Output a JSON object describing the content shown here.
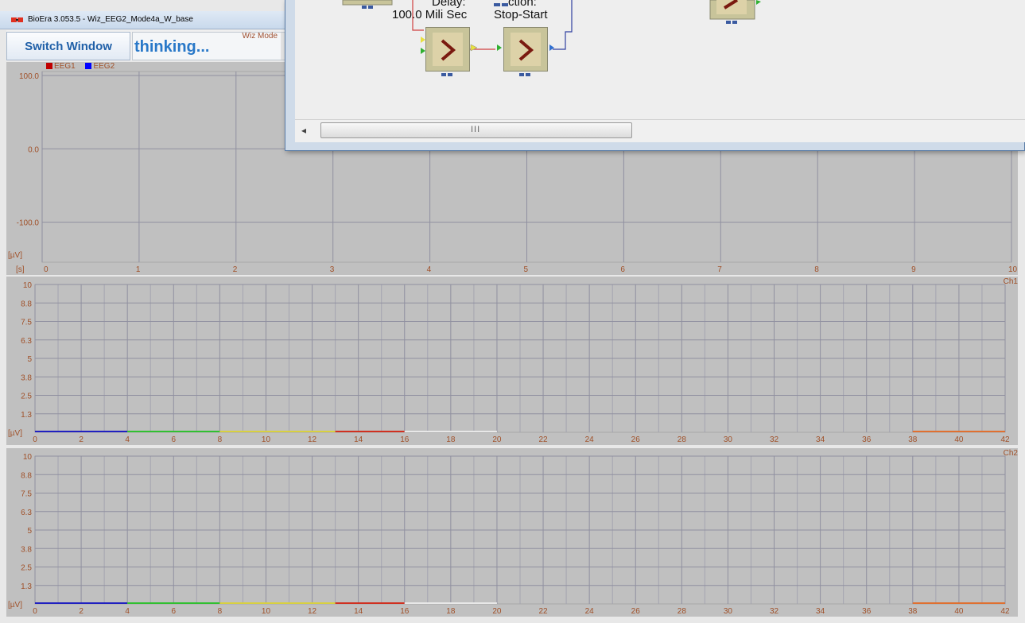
{
  "window": {
    "title": "BioEra 3.053.5 - Wiz_EEG2_Mode4a_W_base",
    "app_icon": "bioera-icon"
  },
  "toolbar": {
    "switch_label": "Switch Window",
    "status_text": "thinking...",
    "mode_label": "Wiz Mode"
  },
  "plots": [
    {
      "type": "line",
      "legend": [
        {
          "name": "EEG1",
          "color": "#c00000"
        },
        {
          "name": "EEG2",
          "color": "#0000ff"
        }
      ],
      "y_ticks": [
        "100.0",
        "0.0",
        "-100.0"
      ],
      "y_unit": "[µV]",
      "x_unit": "[s]",
      "x_ticks": [
        "0",
        "1",
        "2",
        "3",
        "4",
        "5",
        "6",
        "7",
        "8",
        "9",
        "10"
      ],
      "grid": true
    },
    {
      "type": "bar",
      "channel": "Ch1",
      "y_ticks": [
        "10",
        "8.8",
        "7.5",
        "6.3",
        "5",
        "3.8",
        "2.5",
        "1.3"
      ],
      "y_unit": "[µV]",
      "x_ticks": [
        "0",
        "2",
        "4",
        "6",
        "8",
        "10",
        "12",
        "14",
        "16",
        "18",
        "20",
        "22",
        "24",
        "26",
        "28",
        "30",
        "32",
        "34",
        "36",
        "38",
        "40",
        "42"
      ],
      "band_segments": [
        {
          "from": 0,
          "to": 4,
          "color": "#2020c0"
        },
        {
          "from": 4,
          "to": 8,
          "color": "#30c030"
        },
        {
          "from": 8,
          "to": 13,
          "color": "#d8d040"
        },
        {
          "from": 13,
          "to": 16,
          "color": "#d03020"
        },
        {
          "from": 16,
          "to": 20,
          "color": "#e8e8e8"
        },
        {
          "from": 38,
          "to": 42,
          "color": "#e07030"
        }
      ]
    },
    {
      "type": "bar",
      "channel": "Ch2",
      "y_ticks": [
        "10",
        "8.8",
        "7.5",
        "6.3",
        "5",
        "3.8",
        "2.5",
        "1.3"
      ],
      "y_unit": "[µV]",
      "x_ticks": [
        "0",
        "2",
        "4",
        "6",
        "8",
        "10",
        "12",
        "14",
        "16",
        "18",
        "20",
        "22",
        "24",
        "26",
        "28",
        "30",
        "32",
        "34",
        "36",
        "38",
        "40",
        "42"
      ],
      "band_segments": [
        {
          "from": 0,
          "to": 4,
          "color": "#2020c0"
        },
        {
          "from": 4,
          "to": 8,
          "color": "#30c030"
        },
        {
          "from": 8,
          "to": 13,
          "color": "#d8d040"
        },
        {
          "from": 13,
          "to": 16,
          "color": "#d03020"
        },
        {
          "from": 16,
          "to": 20,
          "color": "#e8e8e8"
        },
        {
          "from": 38,
          "to": 42,
          "color": "#e07030"
        }
      ]
    }
  ],
  "designer": {
    "block_labels": {
      "delay_line1": "Delay:",
      "delay_line2": "100.0 Mili Sec",
      "action_line1": "ction:",
      "action_line2": "Stop-Start"
    },
    "scroll_grip": "III"
  }
}
